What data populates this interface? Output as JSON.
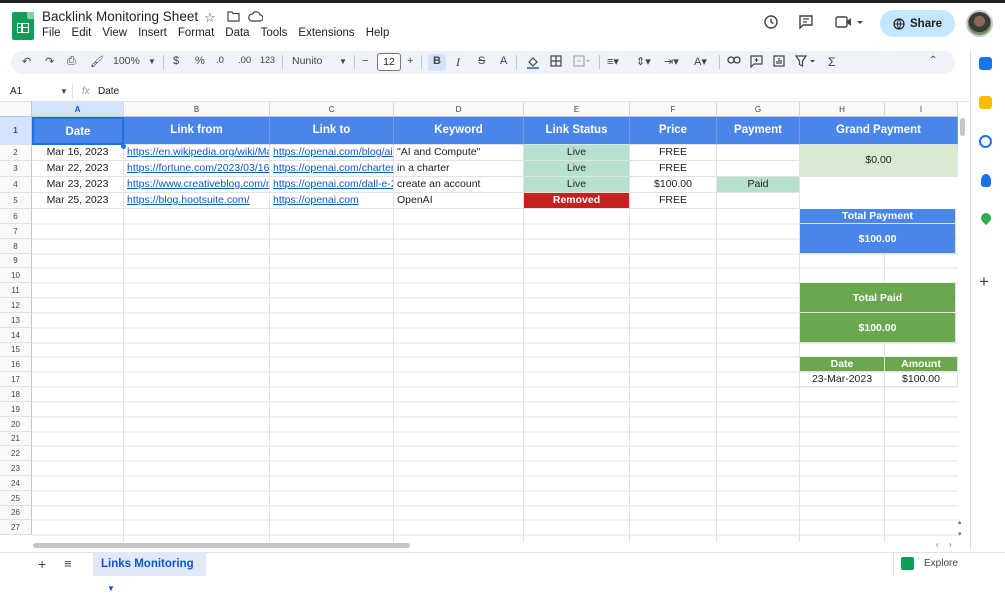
{
  "app": {
    "title": "Backlink Monitoring Sheet",
    "menu": [
      "File",
      "Edit",
      "View",
      "Insert",
      "Format",
      "Data",
      "Tools",
      "Extensions",
      "Help"
    ],
    "share_label": "Share",
    "brand_color": "#0f9d58"
  },
  "toolbar": {
    "zoom": "100%",
    "currency": "$",
    "percent": "%",
    "dec_decrease": ".0",
    "dec_increase": ".00",
    "number_format": "123",
    "font": "Nunito",
    "font_size": "12",
    "bold": "B",
    "italic": "I",
    "strike": "S",
    "text_color": "A"
  },
  "formula_bar": {
    "cell_ref": "A1",
    "fx": "fx",
    "value": "Date"
  },
  "columns": [
    "A",
    "B",
    "C",
    "D",
    "E",
    "F",
    "G",
    "H",
    "I"
  ],
  "rows": [
    "1",
    "2",
    "3",
    "4",
    "5",
    "6",
    "7",
    "8",
    "9",
    "10",
    "11",
    "12",
    "13",
    "14",
    "15",
    "16",
    "17",
    "18",
    "19",
    "20",
    "21",
    "22",
    "23",
    "24",
    "25",
    "26",
    "27"
  ],
  "table": {
    "headers": [
      "Date",
      "Link from",
      "Link to",
      "Keyword",
      "Link Status",
      "Price",
      "Payment"
    ],
    "rows": [
      {
        "date": "Mar 16, 2023",
        "from": "https://en.wikipedia.org/wiki/Ma",
        "to": "https://openai.com/blog/ai-",
        "keyword": "\"AI and Compute\"",
        "status": "Live",
        "price": "FREE",
        "payment": ""
      },
      {
        "date": "Mar 22, 2023",
        "from": "https://fortune.com/2023/03/16",
        "to": "https://openai.com/charter",
        "keyword": "in a charter",
        "status": "Live",
        "price": "FREE",
        "payment": ""
      },
      {
        "date": "Mar 23, 2023",
        "from": "https://www.creativeblog.com/n",
        "to": "https://openai.com/dall-e-2",
        "keyword": "create an account",
        "status": "Live",
        "price": "$100.00",
        "payment": "Paid"
      },
      {
        "date": "Mar 25, 2023",
        "from": "https://blog.hootsuite.com/",
        "to": "https://openai.com",
        "keyword": "OpenAI",
        "status": "Removed",
        "price": "FREE",
        "payment": ""
      }
    ]
  },
  "summary": {
    "grand_payment_label": "Grand Payment",
    "grand_payment_value": "$0.00",
    "total_payment_label": "Total Payment",
    "total_payment_value": "$100.00",
    "total_paid_label": "Total Paid",
    "total_paid_value": "$100.00",
    "paid_table": {
      "headers": [
        "Date",
        "Amount"
      ],
      "rows": [
        {
          "date": "23-Mar-2023",
          "amount": "$100.00"
        }
      ]
    }
  },
  "colors": {
    "header_blue": "#4a86e8",
    "live_green": "#b7e1cd",
    "removed_red": "#c5221f",
    "paid_green": "#6aa84f"
  },
  "sheet_tab": "Links Monitoring",
  "explore_label": "Explore"
}
